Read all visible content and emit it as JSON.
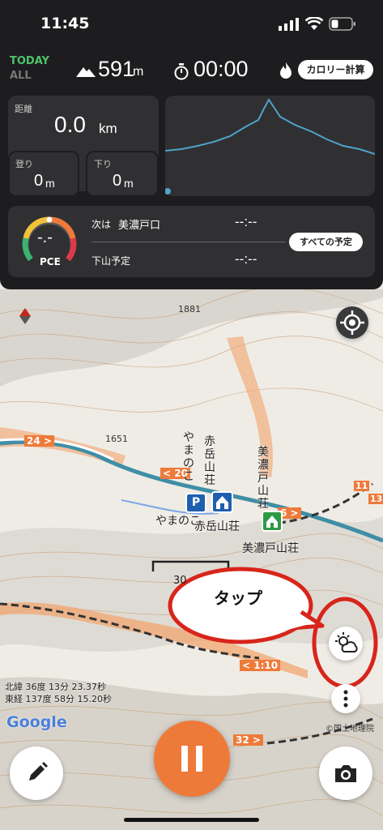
{
  "status": {
    "time": "11:45"
  },
  "header": {
    "today": "TODAY",
    "all": "ALL",
    "altitude": "591",
    "altitude_unit": "m",
    "elapsed": "00:00",
    "calorie_button": "カロリー計算"
  },
  "stats": {
    "distance_label": "距離",
    "distance_value": "0.0",
    "distance_unit": "km",
    "ascent_label": "登り",
    "ascent_value": "0",
    "ascent_unit": "m",
    "descent_label": "下り",
    "descent_value": "0",
    "descent_unit": "m"
  },
  "pace": {
    "pce_value": "-.-",
    "pce_label": "PCE",
    "next_prefix": "次は",
    "next_name": "美濃戸口",
    "next_time": "--:--",
    "descent_label": "下山予定",
    "descent_time": "--:--",
    "schedule_button": "すべての予定"
  },
  "map": {
    "peak_label": "1881",
    "elev_label_2": "1651",
    "route_24": "24 >",
    "route_20": "< 20",
    "route_6": "6 >",
    "route_110": "< 1:10",
    "route_32": "32 >",
    "route_11": "11",
    "route_13": "13",
    "hut_yamanoko_vertical": "やまのこ",
    "hut_yamanoko": "やまのこ",
    "hut_akadake_vertical": "赤岳山荘",
    "hut_akadake": "赤岳山荘",
    "hut_minoto_vertical": "美濃戸山荘",
    "hut_minoto": "美濃戸山荘",
    "scale_label": "30",
    "callout": "タップ",
    "coord_lat": "北緯 36度 13分 23.37秒",
    "coord_lon": "東経 137度 58分 15.20秒",
    "google": "Google",
    "attribution": "©国土地理院",
    "parking_badge": "P"
  },
  "colors": {
    "accent_orange": "#ee7a3a",
    "today_green": "#4fc36a",
    "chart_line": "#4ea3c9",
    "callout_red": "#d8251b"
  }
}
